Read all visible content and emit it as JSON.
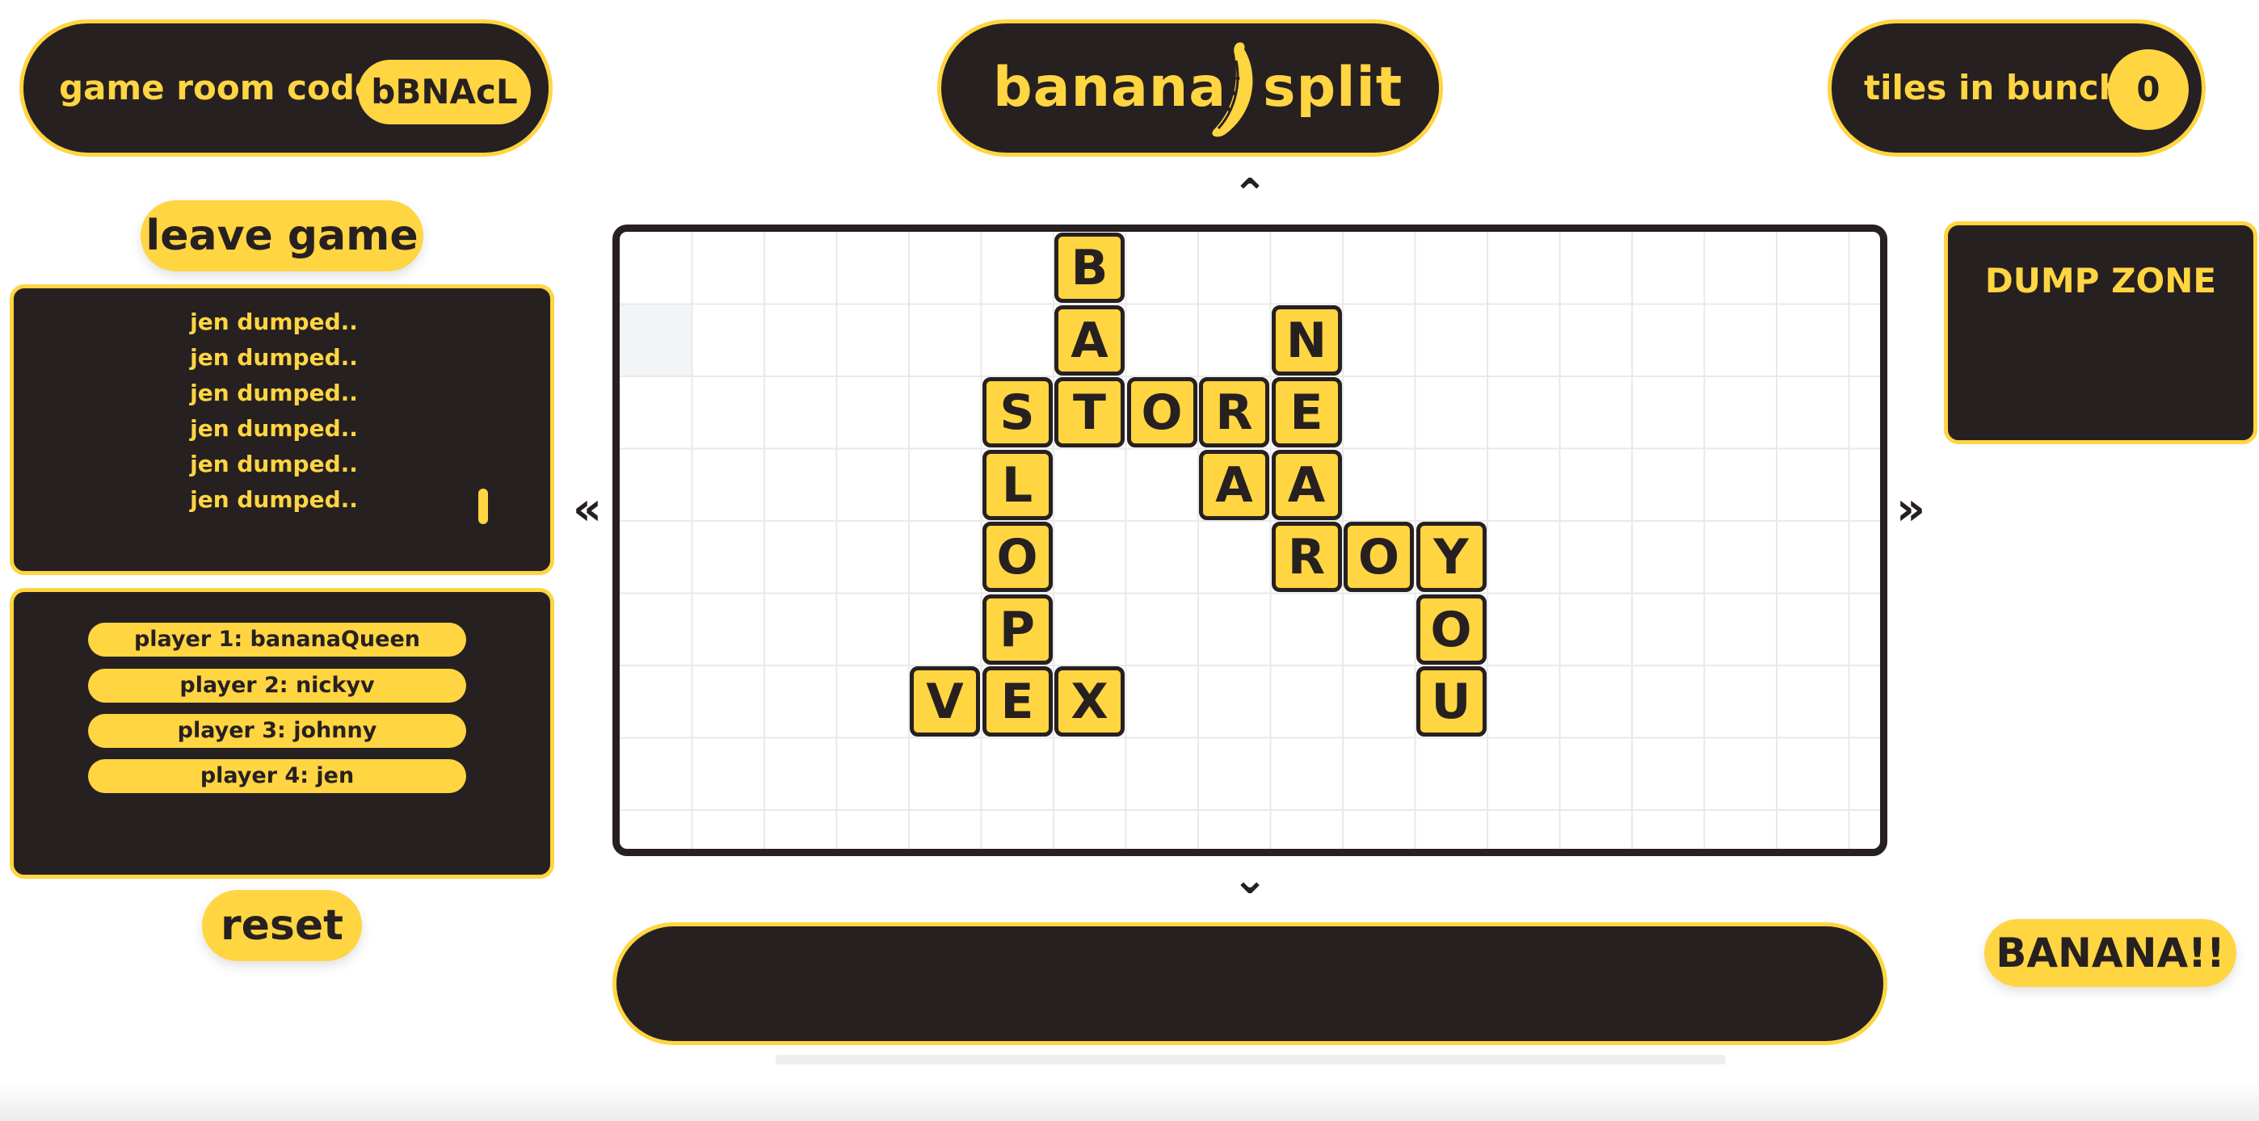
{
  "header": {
    "room_label": "game room code:",
    "room_code": "bBNAcL",
    "logo_word_1": "banana",
    "logo_word_2": "split",
    "logo_icon": "banana-icon",
    "bunch_label": "tiles in bunch:",
    "bunch_count": "0"
  },
  "sidebar": {
    "leave_label": "leave game",
    "log": [
      "jen dumped..",
      "jen dumped..",
      "jen dumped..",
      "jen dumped..",
      "jen dumped..",
      "jen dumped.."
    ],
    "players": [
      "player 1: bananaQueen",
      "player 2: nickyv",
      "player 3: johnny",
      "player 4: jen"
    ],
    "reset_label": "reset"
  },
  "board": {
    "arrows": {
      "up": "⌃",
      "down": "⌄",
      "left": "«",
      "right": "»"
    },
    "tiles": [
      {
        "letter": "B",
        "col": 6,
        "row": 0
      },
      {
        "letter": "A",
        "col": 6,
        "row": 1
      },
      {
        "letter": "N",
        "col": 9,
        "row": 1
      },
      {
        "letter": "S",
        "col": 5,
        "row": 2
      },
      {
        "letter": "T",
        "col": 6,
        "row": 2
      },
      {
        "letter": "O",
        "col": 7,
        "row": 2
      },
      {
        "letter": "R",
        "col": 8,
        "row": 2
      },
      {
        "letter": "E",
        "col": 9,
        "row": 2
      },
      {
        "letter": "L",
        "col": 5,
        "row": 3
      },
      {
        "letter": "A",
        "col": 8,
        "row": 3
      },
      {
        "letter": "A",
        "col": 9,
        "row": 3
      },
      {
        "letter": "O",
        "col": 5,
        "row": 4
      },
      {
        "letter": "R",
        "col": 9,
        "row": 4
      },
      {
        "letter": "O",
        "col": 10,
        "row": 4
      },
      {
        "letter": "Y",
        "col": 11,
        "row": 4
      },
      {
        "letter": "P",
        "col": 5,
        "row": 5
      },
      {
        "letter": "O",
        "col": 11,
        "row": 5
      },
      {
        "letter": "V",
        "col": 4,
        "row": 6
      },
      {
        "letter": "E",
        "col": 5,
        "row": 6
      },
      {
        "letter": "X",
        "col": 6,
        "row": 6
      },
      {
        "letter": "U",
        "col": 11,
        "row": 6
      }
    ]
  },
  "dump_zone": {
    "label": "DUMP ZONE"
  },
  "actions": {
    "banana_label": "BANANA!!"
  },
  "colors": {
    "yellow": "#ffd542",
    "dark": "#272020",
    "grid": "#e9e9e9"
  }
}
